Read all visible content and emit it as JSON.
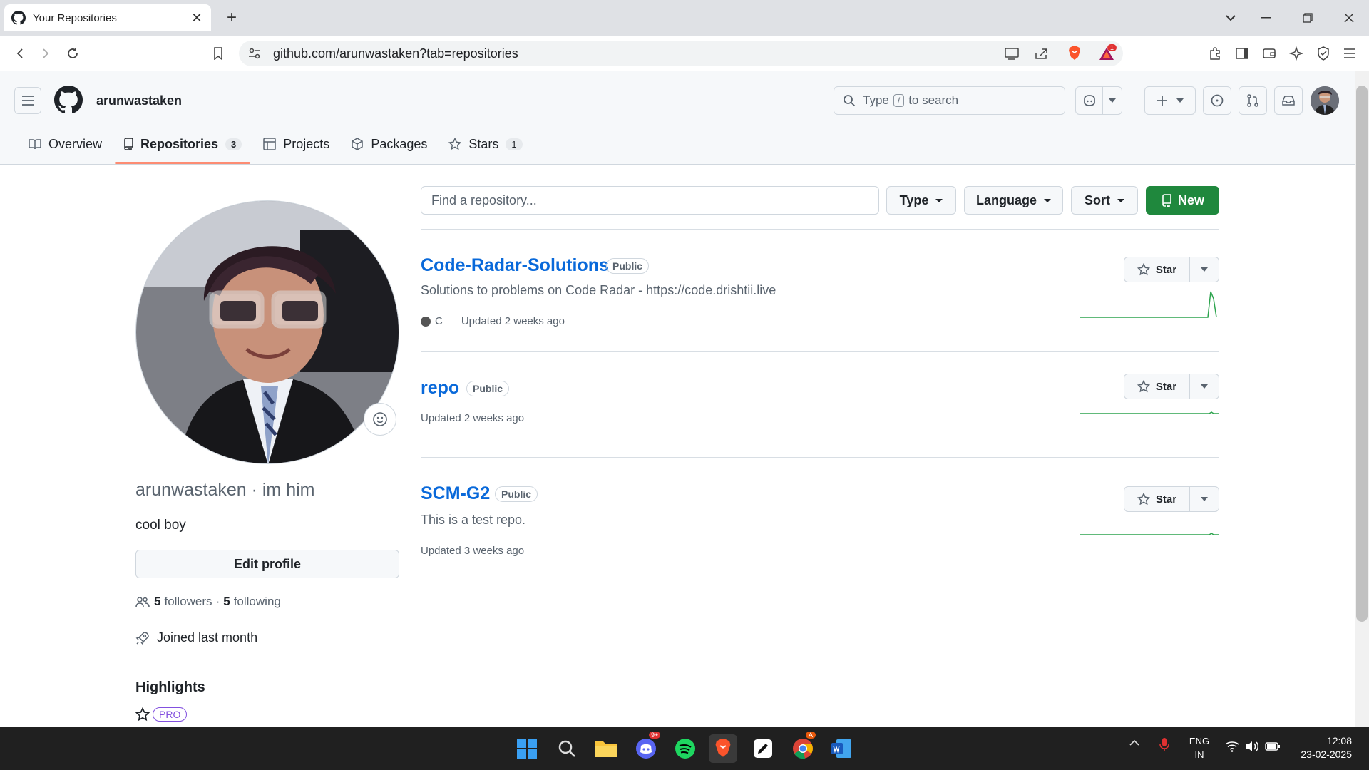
{
  "browser": {
    "tab_title": "Your Repositories",
    "url": "github.com/arunwastaken?tab=repositories",
    "brave_notification_count": "1"
  },
  "header": {
    "username": "arunwastaken",
    "search_placeholder_pre": "Type",
    "search_key": "/",
    "search_placeholder_post": "to search"
  },
  "tabs": [
    {
      "label": "Overview",
      "icon": "book-icon"
    },
    {
      "label": "Repositories",
      "count": "3",
      "icon": "repo-icon"
    },
    {
      "label": "Projects",
      "icon": "table-icon"
    },
    {
      "label": "Packages",
      "icon": "package-icon"
    },
    {
      "label": "Stars",
      "count": "1",
      "icon": "star-icon"
    }
  ],
  "profile": {
    "name_line": "arunwastaken · im him",
    "bio": "cool boy",
    "edit_label": "Edit profile",
    "followers_count": "5",
    "followers_label": "followers",
    "separator": "·",
    "following_count": "5",
    "following_label": "following",
    "joined": "Joined last month",
    "highlights_title": "Highlights",
    "pro_badge": "PRO"
  },
  "filters": {
    "find_placeholder": "Find a repository...",
    "type_label": "Type",
    "language_label": "Language",
    "sort_label": "Sort",
    "new_label": "New"
  },
  "repos": [
    {
      "name": "Code-Radar-Solutions",
      "visibility": "Public",
      "description": "Solutions to problems on Code Radar - https://code.drishtii.live",
      "language": "C",
      "updated": "Updated 2 weeks ago",
      "star_label": "Star"
    },
    {
      "name": "repo",
      "visibility": "Public",
      "description": "",
      "language": "",
      "updated": "Updated 2 weeks ago",
      "star_label": "Star"
    },
    {
      "name": "SCM-G2",
      "visibility": "Public",
      "description": "This is a test repo.",
      "language": "",
      "updated": "Updated 3 weeks ago",
      "star_label": "Star"
    }
  ],
  "taskbar": {
    "lang_line1": "ENG",
    "lang_line2": "IN",
    "time": "12:08",
    "date": "23-02-2025",
    "discord_badge": "9+",
    "chrome_badge": "A"
  },
  "colors": {
    "accent_green": "#1f883d",
    "link_blue": "#0969da",
    "tab_underline": "#fd8c73",
    "spark_green": "#2da44e"
  }
}
